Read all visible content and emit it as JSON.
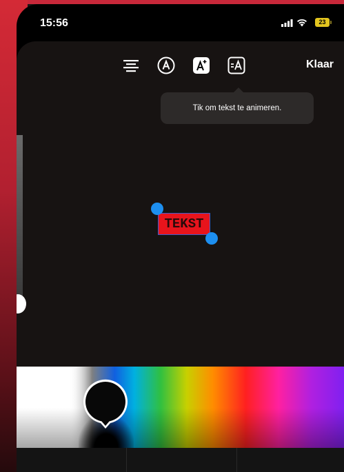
{
  "status_bar": {
    "time": "15:56",
    "battery_level": "23",
    "battery_color": "#e3c51f"
  },
  "toolbar": {
    "icons": [
      "text-align-icon",
      "font-style-icon",
      "text-background-icon",
      "animate-text-icon"
    ],
    "done_label": "Klaar"
  },
  "tooltip": {
    "text": "Tik om tekst te animeren."
  },
  "canvas": {
    "text_value": "TEKST",
    "text_background_color": "#e8141c",
    "selection_handle_color": "#1d8ff0"
  },
  "color_picker": {
    "selected_color": "#000000"
  }
}
